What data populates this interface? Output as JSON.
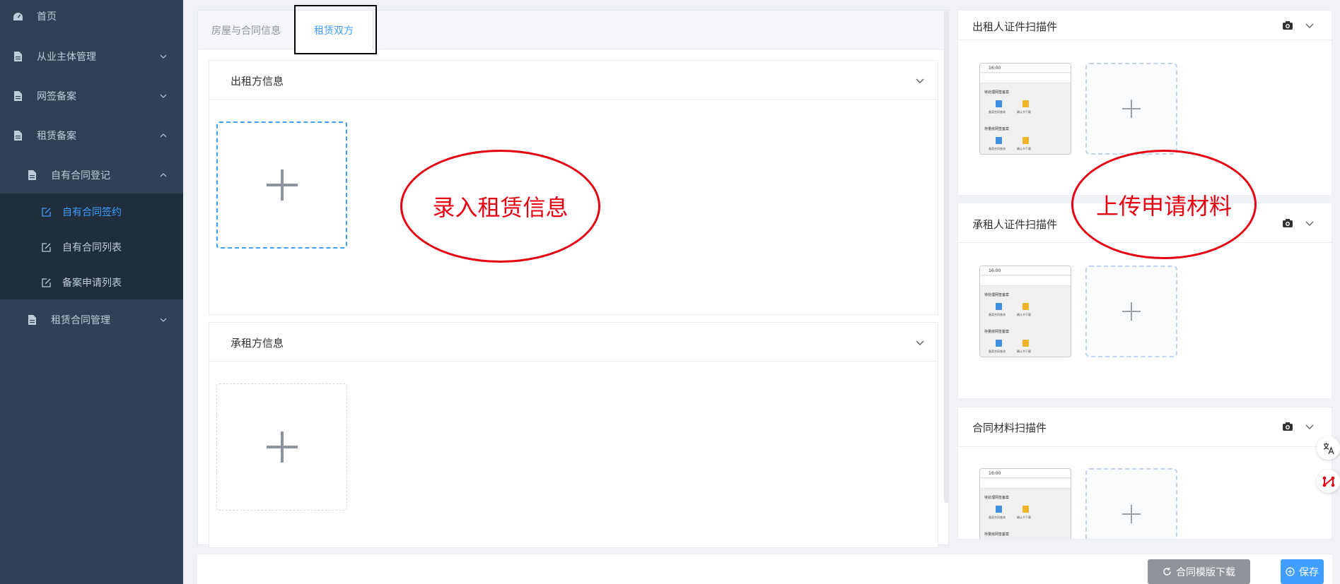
{
  "sidebar": {
    "items": [
      {
        "label": "首页"
      },
      {
        "label": "从业主体管理"
      },
      {
        "label": "网签备案"
      },
      {
        "label": "租赁备案"
      },
      {
        "label": "自有合同登记"
      },
      {
        "label": "自有合同签约",
        "active": true
      },
      {
        "label": "自有合同列表"
      },
      {
        "label": "备案申请列表"
      },
      {
        "label": "租赁合同管理"
      }
    ]
  },
  "tabs": [
    {
      "label": "房屋与合同信息",
      "active": false
    },
    {
      "label": "租赁双方",
      "active": true
    }
  ],
  "panels": {
    "lessor": {
      "title": "出租方信息"
    },
    "lessee": {
      "title": "承租方信息"
    }
  },
  "scans": {
    "lessor_id": {
      "title": "出租人证件扫描件"
    },
    "lessee_id": {
      "title": "承租人证件扫描件"
    },
    "contract": {
      "title": "合同材料扫描件"
    }
  },
  "thumbnail": {
    "time": "16:00",
    "section1": "待处理网签备案",
    "section2": "存量房网签备案",
    "item1": "备案合同查询",
    "item2": "确认书下载",
    "item3": "备案合同查询",
    "item4": "确认书下载"
  },
  "annotations": {
    "left": "录入租赁信息",
    "right": "上传申请材料"
  },
  "footer": {
    "download_label": "合同模版下载",
    "save_label": "保存"
  },
  "colors": {
    "sidebar_bg": "#304156",
    "sidebar_active_bg": "#1f2d3d",
    "accent": "#409eff",
    "annotation": "#e60012"
  }
}
